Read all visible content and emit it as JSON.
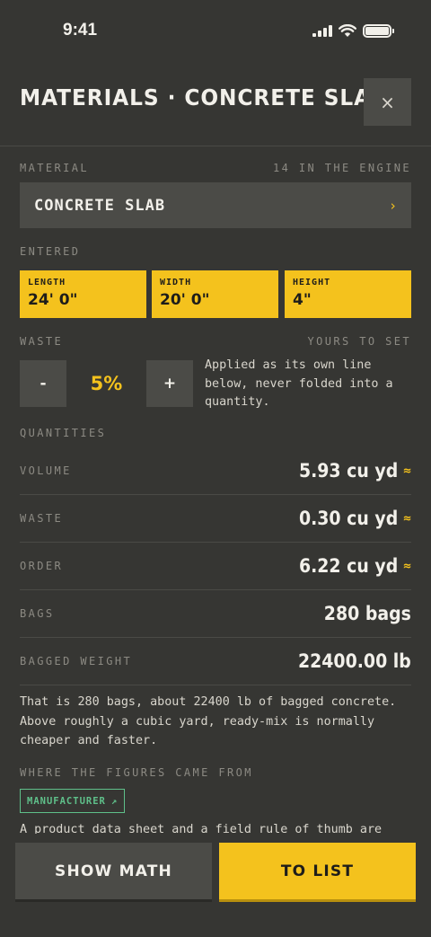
{
  "status": {
    "time": "9:41"
  },
  "header": {
    "title": "MATERIALS · CONCRETE SLAB",
    "close_label": "×"
  },
  "material": {
    "label": "MATERIAL",
    "count_label": "14 IN THE ENGINE",
    "value": "CONCRETE SLAB",
    "chevron": "›"
  },
  "entered": {
    "label": "ENTERED",
    "dimensions": [
      {
        "label": "LENGTH",
        "value": "24' 0\""
      },
      {
        "label": "WIDTH",
        "value": "20' 0\""
      },
      {
        "label": "HEIGHT",
        "value": "4\""
      }
    ]
  },
  "waste": {
    "label": "WASTE",
    "hint": "YOURS TO SET",
    "minus_label": "-",
    "plus_label": "+",
    "value": "5%",
    "percent": 5,
    "note": "Applied as its own line below, never folded into a quantity."
  },
  "quantities": {
    "label": "QUANTITIES",
    "rows": [
      {
        "label": "VOLUME",
        "value": "5.93 cu yd",
        "approx": "≈"
      },
      {
        "label": "WASTE",
        "value": "0.30 cu yd",
        "approx": "≈"
      },
      {
        "label": "ORDER",
        "value": "6.22 cu yd",
        "approx": "≈"
      },
      {
        "label": "BAGS",
        "value": "280 bags",
        "approx": ""
      },
      {
        "label": "BAGGED WEIGHT",
        "value": "22400.00 lb",
        "approx": ""
      }
    ]
  },
  "summary": "That is 280 bags, about 22400 lb of bagged concrete. Above roughly a cubic yard, ready-mix is normally cheaper and faster.",
  "sources": {
    "label": "WHERE THE FIGURES CAME FROM",
    "badge": "MANUFACTURER",
    "badge_icon": "↗",
    "footnote": "A product data sheet and a field rule of thumb are"
  },
  "actions": {
    "show_math": "SHOW MATH",
    "to_list": "TO LIST"
  },
  "colors": {
    "accent": "#f4c21d",
    "background": "#363633",
    "panel": "#4b4b47",
    "source": "#5fc08a"
  }
}
